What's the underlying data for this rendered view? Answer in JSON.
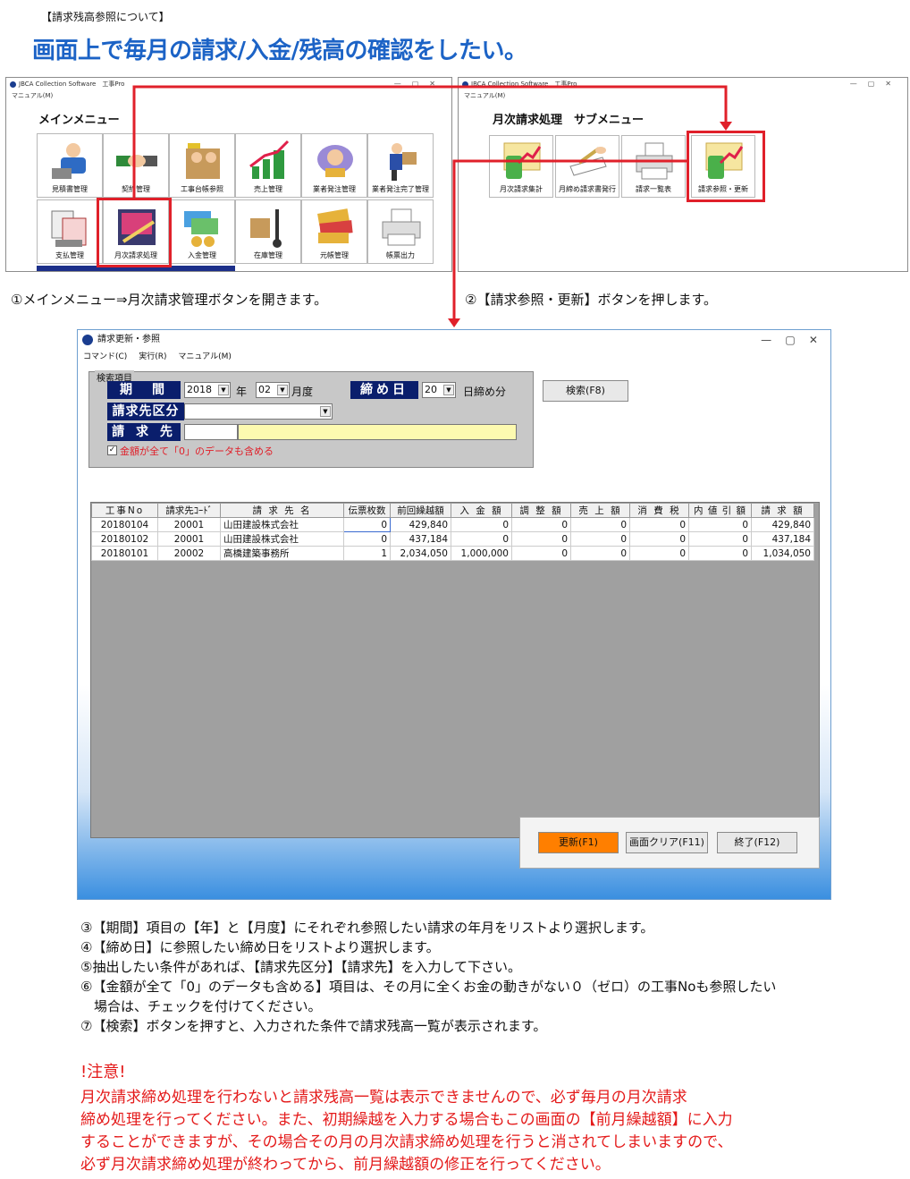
{
  "page": {
    "tag": "【請求残高参照について】",
    "heading": "画面上で毎月の請求/入金/残高の確認をしたい。"
  },
  "main_window": {
    "title": "JBCA Collection Software　工事Pro",
    "menubar": "マニュアル(M)",
    "heading": "メインメニュー",
    "tiles": [
      {
        "label": "見積書管理"
      },
      {
        "label": "契約管理"
      },
      {
        "label": "工事台帳参照"
      },
      {
        "label": "売上管理"
      },
      {
        "label": "業者発注管理"
      },
      {
        "label": "業者発注完了管理"
      },
      {
        "label": "支払管理"
      },
      {
        "label": "月次請求処理"
      },
      {
        "label": "入金管理"
      },
      {
        "label": "在庫管理"
      },
      {
        "label": "元帳管理"
      },
      {
        "label": "帳票出力"
      }
    ]
  },
  "sub_window": {
    "title": "JBCA Collection Software　工事Pro",
    "menubar": "マニュアル(M)",
    "heading": "月次請求処理　サブメニュー",
    "tiles": [
      {
        "label": "月次請求集計"
      },
      {
        "label": "月締め請求書発行"
      },
      {
        "label": "請求一覧表"
      },
      {
        "label": "請求参照・更新"
      }
    ]
  },
  "steps": {
    "step1": "①メインメニュー⇒月次請求管理ボタンを開きます。",
    "step2": "②【請求参照・更新】ボタンを押します。"
  },
  "billing_window": {
    "title": "請求更新・参照",
    "menu": [
      "コマンド(C)",
      "実行(R)",
      "マニュアル(M)"
    ],
    "search_group": "検索項目",
    "period_label": "期　間",
    "year_value": "2018",
    "year_suffix": "年",
    "month_value": "02",
    "month_suffix": "月度",
    "closing_label": "締め日",
    "closing_value": "20",
    "closing_suffix": "日締め分",
    "customer_class_label": "請求先区分",
    "customer_label": "請 求 先",
    "include_zero_label": "金額が全て「0」のデータも含める",
    "include_zero_checked": true,
    "search_button": "検索(F8)",
    "columns": [
      "工事No",
      "請求先ｺｰﾄﾞ",
      "請 求 先 名",
      "伝票枚数",
      "前回繰越額",
      "入 金 額",
      "調 整 額",
      "売 上 額",
      "消 費 税",
      "内 値 引 額",
      "請 求 額"
    ],
    "rows": [
      [
        "20180104",
        "20001",
        "山田建設株式会社",
        "0",
        "429,840",
        "0",
        "0",
        "0",
        "0",
        "0",
        "429,840"
      ],
      [
        "20180102",
        "20001",
        "山田建設株式会社",
        "0",
        "437,184",
        "0",
        "0",
        "0",
        "0",
        "0",
        "437,184"
      ],
      [
        "20180101",
        "20002",
        "高橋建築事務所",
        "1",
        "2,034,050",
        "1,000,000",
        "0",
        "0",
        "0",
        "0",
        "1,034,050"
      ]
    ],
    "update_button": "更新(F1)",
    "clear_button": "画面クリア(F11)",
    "exit_button": "終了(F12)"
  },
  "instructions": [
    "③【期間】項目の【年】と【月度】にそれぞれ参照したい請求の年月をリストより選択します。",
    "④【締め日】に参照したい締め日をリストより選択します。",
    "⑤抽出したい条件があれば、【請求先区分】【請求先】を入力して下さい。",
    "⑥【金額が全て「0」のデータも含める】項目は、その月に全くお金の動きがない０（ゼロ）の工事Noも参照したい",
    "　場合は、チェックを付けてください。",
    "⑦【検索】ボタンを押すと、入力された条件で請求残高一覧が表示されます。"
  ],
  "caution": {
    "title": "!注意!",
    "lines": [
      "月次請求締め処理を行わないと請求残高一覧は表示できませんので、必ず毎月の月次請求",
      "締め処理を行ってください。また、初期繰越を入力する場合もこの画面の【前月繰越額】に入力",
      "することができますが、その場合その月の月次請求締め処理を行うと消されてしまいますので、",
      "必ず月次請求締め処理が終わってから、前月繰越額の修正を行ってください。"
    ]
  },
  "colors": {
    "heading_blue": "#1c63c6",
    "highlight_red": "#e0202a",
    "navy_label": "#0a1e6c",
    "update_orange": "#ff7f00"
  }
}
